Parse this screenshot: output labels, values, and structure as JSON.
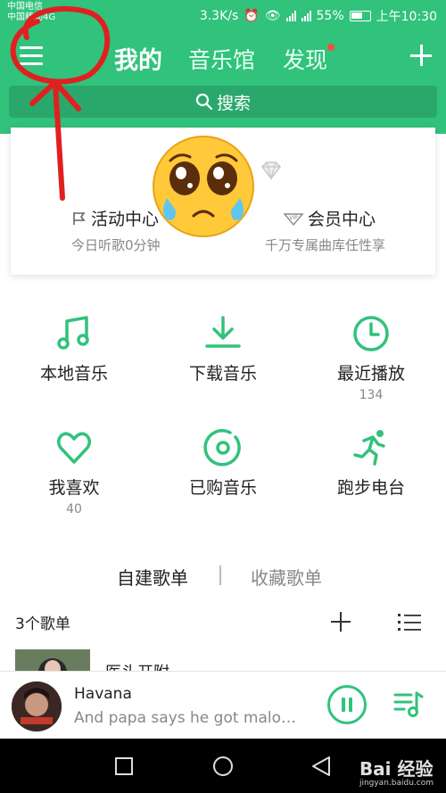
{
  "status_bar": {
    "carrier_1": "中国电信",
    "carrier_2": "中国移动4G",
    "speed": "3.3K/s",
    "battery": "55%",
    "time": "上午10:30"
  },
  "header": {
    "tabs": [
      {
        "label": "我的",
        "active": true
      },
      {
        "label": "音乐馆",
        "active": false
      },
      {
        "label": "发现",
        "active": false
      }
    ]
  },
  "search": {
    "placeholder": "搜索"
  },
  "profile_card": {
    "activity": {
      "title": "活动中心",
      "subtitle": "今日听歌0分钟"
    },
    "vip": {
      "title": "会员中心",
      "subtitle": "千万专属曲库任性享"
    }
  },
  "grid": [
    {
      "label": "本地音乐",
      "count": "",
      "icon": "music-note-icon"
    },
    {
      "label": "下载音乐",
      "count": "",
      "icon": "download-icon"
    },
    {
      "label": "最近播放",
      "count": "134",
      "icon": "clock-icon"
    },
    {
      "label": "我喜欢",
      "count": "40",
      "icon": "heart-icon"
    },
    {
      "label": "已购音乐",
      "count": "",
      "icon": "disc-icon"
    },
    {
      "label": "跑步电台",
      "count": "",
      "icon": "runner-icon"
    }
  ],
  "playlists": {
    "tabs": [
      "自建歌单",
      "收藏歌单"
    ],
    "count_label": "3个歌单",
    "first_row_title": "医头开附"
  },
  "player": {
    "title": "Havana",
    "lyric": "And papa says he got malo…"
  },
  "watermark": {
    "brand": "Bai 经验",
    "url": "jingyan.baidu.com"
  },
  "colors": {
    "accent": "#31c27c",
    "annotation": "#e02020"
  }
}
